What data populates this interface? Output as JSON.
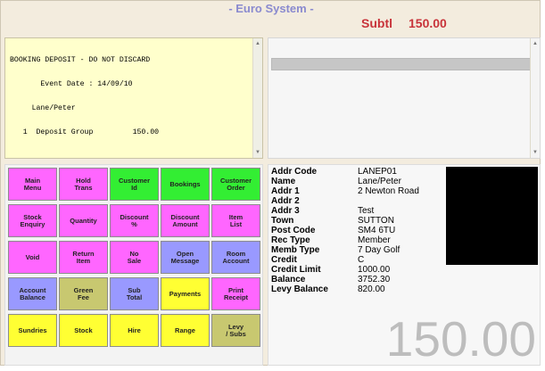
{
  "app": {
    "title": "- Euro System -"
  },
  "subtotal": {
    "label": "Subtl",
    "value": "150.00"
  },
  "receipt": {
    "lines": [
      "BOOKING DEPOSIT - DO NOT DISCARD",
      "       Event Date : 14/09/10",
      "     Lane/Peter",
      "   1  Deposit Group         150.00"
    ]
  },
  "keys": [
    {
      "label": "Main\nMenu",
      "color": "#ff66ff"
    },
    {
      "label": "Hold\nTrans",
      "color": "#ff66ff"
    },
    {
      "label": "Customer\nId",
      "color": "#33ee33"
    },
    {
      "label": "Bookings",
      "color": "#33ee33"
    },
    {
      "label": "Customer\nOrder",
      "color": "#33ee33"
    },
    {
      "label": "Stock\nEnquiry",
      "color": "#ff66ff"
    },
    {
      "label": "Quantity",
      "color": "#ff66ff"
    },
    {
      "label": "Discount\n%",
      "color": "#ff66ff"
    },
    {
      "label": "Discount\nAmount",
      "color": "#ff66ff"
    },
    {
      "label": "Item\nList",
      "color": "#ff66ff"
    },
    {
      "label": "Void",
      "color": "#ff66ff"
    },
    {
      "label": "Return\nItem",
      "color": "#ff66ff"
    },
    {
      "label": "No\nSale",
      "color": "#ff66ff"
    },
    {
      "label": "Open\nMessage",
      "color": "#9999ff"
    },
    {
      "label": "Room\nAccount",
      "color": "#9999ff"
    },
    {
      "label": "Account\nBalance",
      "color": "#9999ff"
    },
    {
      "label": "Green\nFee",
      "color": "#c8c870"
    },
    {
      "label": "Sub\nTotal",
      "color": "#9999ff"
    },
    {
      "label": "Payments",
      "color": "#ffff33"
    },
    {
      "label": "Print\nReceipt",
      "color": "#ff66ff"
    },
    {
      "label": "Sundries",
      "color": "#ffff33"
    },
    {
      "label": "Stock",
      "color": "#ffff33"
    },
    {
      "label": "Hire",
      "color": "#ffff33"
    },
    {
      "label": "Range",
      "color": "#ffff33"
    },
    {
      "label": "Levy\n/ Subs",
      "color": "#c8c870"
    }
  ],
  "customer": {
    "fields": [
      {
        "label": "Addr Code",
        "value": "LANEP01"
      },
      {
        "label": "Name",
        "value": "Lane/Peter"
      },
      {
        "label": "Addr 1",
        "value": "2 Newton Road"
      },
      {
        "label": "Addr 2",
        "value": ""
      },
      {
        "label": "Addr 3",
        "value": "Test"
      },
      {
        "label": "Town",
        "value": "SUTTON"
      },
      {
        "label": "Post Code",
        "value": "SM4 6TU"
      },
      {
        "label": "Rec Type",
        "value": "Member"
      },
      {
        "label": "Memb Type",
        "value": "7 Day Golf"
      },
      {
        "label": "Credit",
        "value": "C"
      },
      {
        "label": "Credit Limit",
        "value": "1000.00"
      },
      {
        "label": "Balance",
        "value": "3752.30"
      },
      {
        "label": "Levy Balance",
        "value": "820.00"
      }
    ]
  },
  "total_display": "150.00"
}
